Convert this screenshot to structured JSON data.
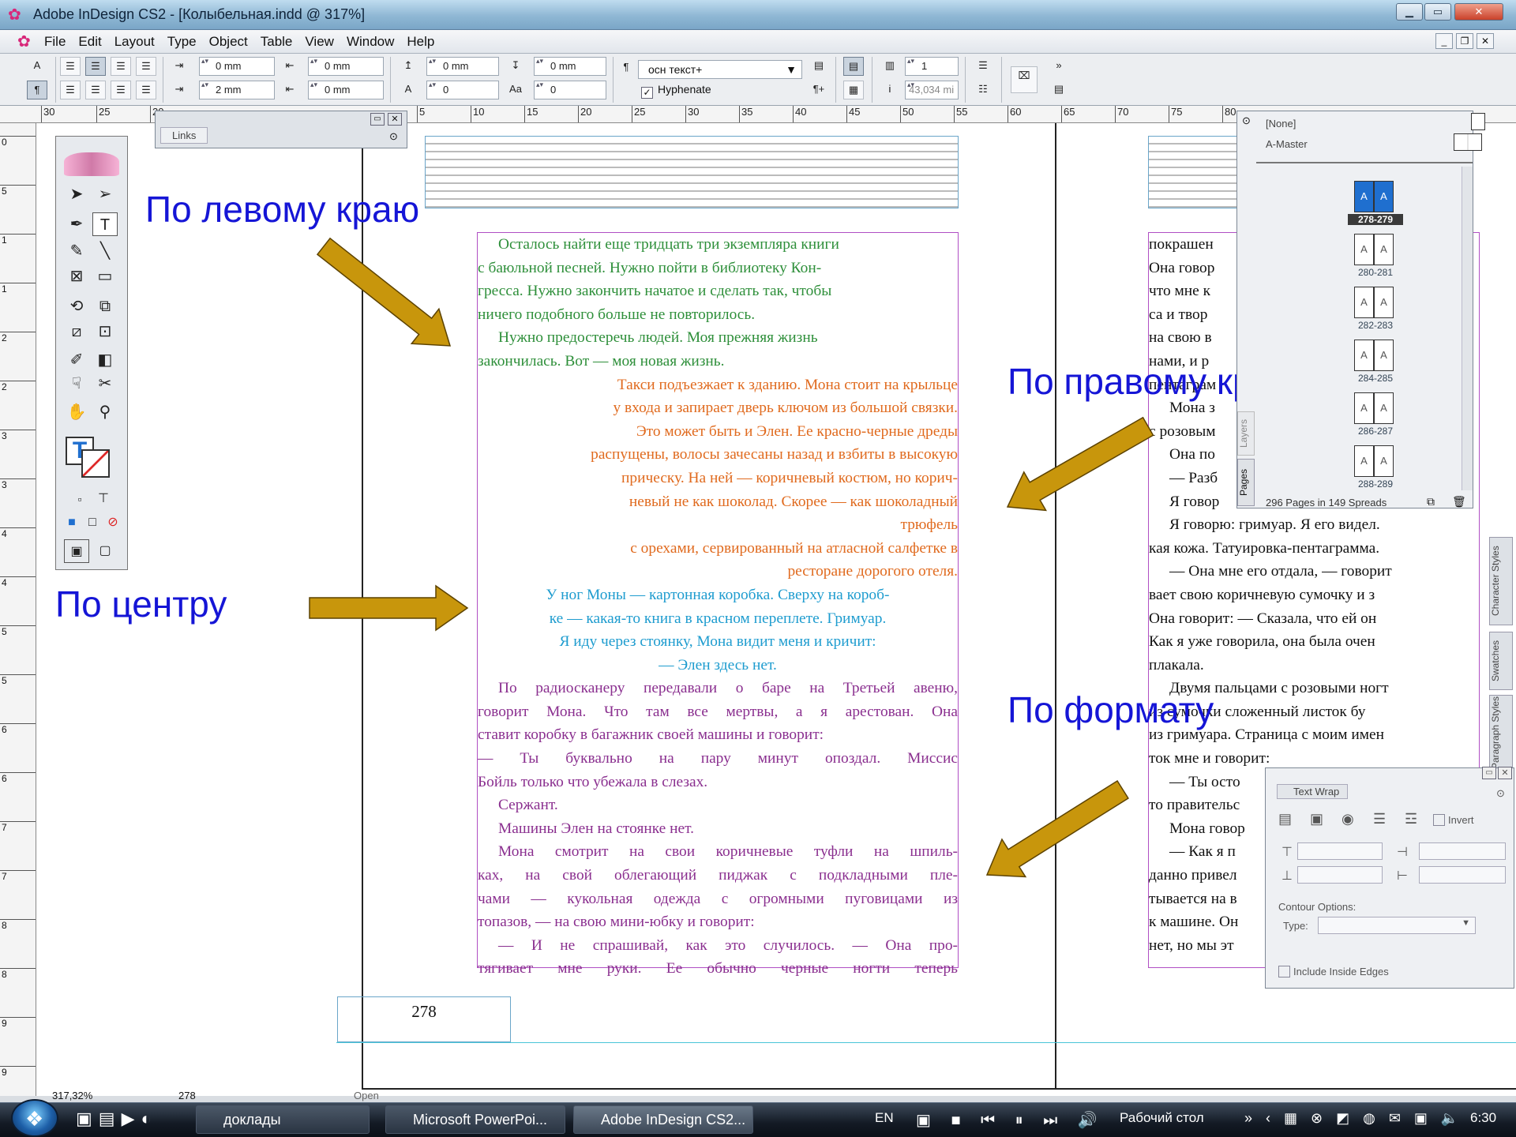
{
  "window": {
    "title": "Adobe InDesign CS2 - [Колыбельная.indd @ 317%]",
    "min_label": "▁",
    "max_label": "▭",
    "close_label": "✕"
  },
  "menu": [
    "File",
    "Edit",
    "Layout",
    "Type",
    "Object",
    "Table",
    "View",
    "Window",
    "Help"
  ],
  "control_panel": {
    "left_indent": "0 mm",
    "right_indent": "0 mm",
    "first_line_indent": "2 mm",
    "last_line_indent": "0 mm",
    "space_before": "0 mm",
    "space_after": "0 mm",
    "drop_cap_lines": "0",
    "drop_cap_chars": "0",
    "paragraph_style": "осн текст+",
    "hyphenate_label": "Hyphenate",
    "columns": "1",
    "column_width": "43,034 mi"
  },
  "ruler_labels": [
    "30",
    "25",
    "20",
    "5",
    "10",
    "15",
    "20",
    "25",
    "30",
    "35",
    "40",
    "45",
    "50",
    "55",
    "60",
    "65",
    "70",
    "75",
    "80"
  ],
  "vruler_labels": [
    "0",
    "5",
    "1",
    "1",
    "2",
    "2",
    "3",
    "3",
    "4",
    "4",
    "5",
    "5",
    "6",
    "6",
    "7",
    "7",
    "8",
    "8",
    "9",
    "9"
  ],
  "links_panel": {
    "tab": "Links"
  },
  "page_number": "278",
  "annotations": {
    "left": "По левому краю",
    "right": "По правому краю",
    "center": "По центру",
    "justify": "По формату"
  },
  "arrow_color": "#c8960c",
  "main_text": {
    "left_aligned": [
      "Осталось найти еще тридцать три экземпляра книги",
      "с баюльной песней. Нужно пойти в библиотеку Кон-",
      "гресса. Нужно закончить начатое и сделать так, чтобы",
      "ничего подобного больше не повторилось.",
      "Нужно предостеречь людей. Моя прежняя жизнь",
      "закончилась. Вот — моя новая жизнь."
    ],
    "right_aligned": [
      "Такси подъезжает к зданию. Мона стоит на крыльце",
      "у входа и запирает дверь ключом из большой связки.",
      "Это может быть и Элен. Ее красно-черные дреды",
      "распущены, волосы зачесаны назад и взбиты в высокую",
      "прическу. На ней — коричневый костюм, но корич-",
      "невый не как шоколад. Скорее — как шоколадный",
      "трюфель",
      "с орехами, сервированный на атласной салфетке в",
      "ресторане дорогого отеля."
    ],
    "centered": [
      "У ног Моны — картонная коробка. Сверху на короб-",
      "ке — какая-то книга в красном переплете. Гримуар.",
      "Я иду через стоянку, Мона видит меня и кричит:",
      "— Элен здесь нет."
    ],
    "justified": [
      "По радиосканеру передавали о баре на Третьей авеню,",
      "говорит Мона. Что там все мертвы, а я арестован. Она",
      "ставит коробку в багажник своей машины и говорит:",
      "— Ты буквально на пару минут опоздал. Миссис",
      "Бойль только что убежала в слезах.",
      "Сержант.",
      "Машины Элен на стоянке нет.",
      "Мона смотрит на свои коричневые туфли на шпиль-",
      "ках, на свой облегающий пиджак с подкладными пле-",
      "чами — кукольная одежда с огромными пуговицами из",
      "топазов, — на свою мини-юбку и говорит:",
      "— И не спрашивай, как это случилось. — Она про-",
      "тягивает мне руки. Ее обычно черные ногти теперь"
    ]
  },
  "right_page_text": [
    "покрашен",
    "Она говор",
    "что мне к",
    "са и твор",
    "на свою в",
    "нами, и р",
    "пентаграм",
    "Мона з",
    "с розовым",
    "Она по",
    "— Разб",
    "Я говор",
    "Я говорю: гримуар. Я его видел.",
    "кая кожа. Татуировка-пентаграмма.",
    "— Она мне его отдала, — говорит",
    "вает свою коричневую сумочку и з",
    "Она говорит: — Сказала, что ей он",
    "Как я уже говорила, она была очен",
    "плакала.",
    "Двумя пальцами с розовыми ногт",
    "из сумочки сложенный листок бу",
    "из гримуара. Страница с моим имен",
    "ток мне и говорит:",
    "— Ты осто",
    "то правительс",
    "Мона говор",
    "— Как я п",
    "данно привел",
    "тывается на в",
    "к машине. Он",
    "нет, но мы эт"
  ],
  "pages_panel": {
    "none_label": "[None]",
    "master_label": "A-Master",
    "spreads": [
      "278-279",
      "280-281",
      "282-283",
      "284-285",
      "286-287",
      "288-289"
    ],
    "page_letter": "A",
    "summary": "296 Pages in 149 Spreads",
    "tab": "Pages",
    "layers_tab": "Layers"
  },
  "side_tabs": [
    "Character Styles",
    "Swatches",
    "Paragraph Styles"
  ],
  "text_wrap": {
    "title": "Text Wrap",
    "invert": "Invert",
    "contour_label": "Contour Options:",
    "type_label": "Type:",
    "include_label": "Include Inside Edges"
  },
  "status": {
    "zoom": "317,32%",
    "page": "278",
    "open": "Open"
  },
  "taskbar": {
    "items": [
      "доклады",
      "Microsoft PowerPoi...",
      "Adobe InDesign CS2..."
    ],
    "lang": "EN",
    "desktop": "Рабочий стол",
    "time": "6:30"
  }
}
